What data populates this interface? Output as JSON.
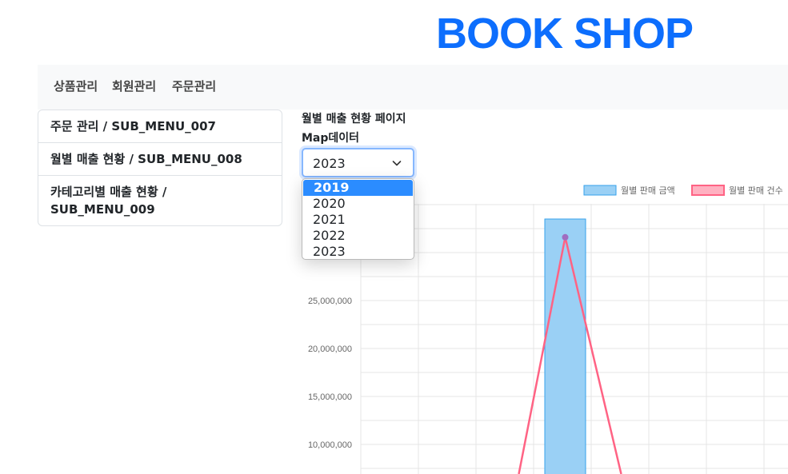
{
  "brand": {
    "title": "BOOK SHOP",
    "color": "#0d6efd"
  },
  "nav": {
    "items": [
      "상품관리",
      "회원관리",
      "주문관리"
    ]
  },
  "sidebar": {
    "items": [
      {
        "label": "주문 관리 / SUB_MENU_007"
      },
      {
        "label": "월별 매출 현황 / SUB_MENU_008"
      },
      {
        "label": "카테고리별 매출 현황 / SUB_MENU_009"
      }
    ]
  },
  "page": {
    "title": "월별 매출 현황 페이지",
    "map_label": "Map데이터"
  },
  "year_select": {
    "value": "2023",
    "options": [
      "2019",
      "2020",
      "2021",
      "2022",
      "2023"
    ],
    "highlighted": "2019",
    "icon": "chevron-down-icon"
  },
  "chart_data": {
    "type": "bar",
    "title": "",
    "xlabel": "",
    "ylabel": "",
    "grid": true,
    "legend_position": "top-right",
    "series": [
      {
        "name": "월별 판매 금액",
        "kind": "bar",
        "color": "#9ad0f5",
        "border": "#36a2eb"
      },
      {
        "name": "월별 판매 건수",
        "kind": "line",
        "color": "#ff6384"
      }
    ],
    "y_ticks": [
      "10,000,000",
      "15,000,000",
      "20,000,000",
      "25,000,000"
    ],
    "visible_y_range": [
      7000000,
      38000000
    ],
    "bar_value": 33500000,
    "line_peak": 31600000
  }
}
